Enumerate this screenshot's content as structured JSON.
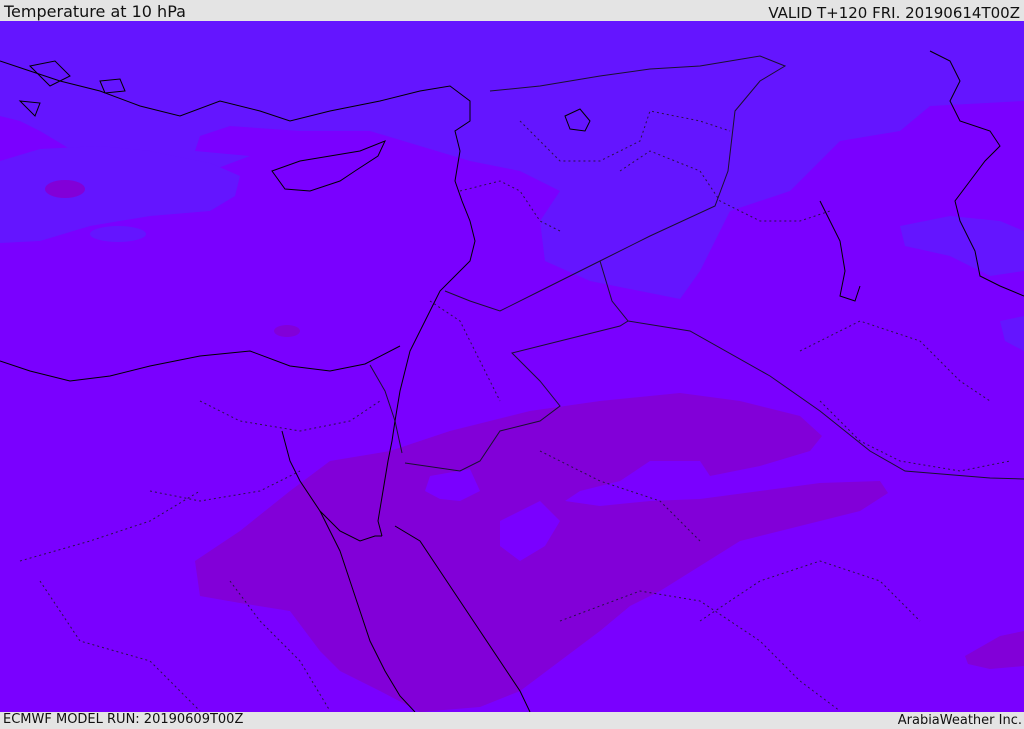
{
  "header": {
    "title": "Temperature at 10 hPa",
    "valid_time": "VALID T+120 FRI. 20190614T00Z"
  },
  "footer": {
    "model_run": "ECMWF MODEL RUN: 20190609T00Z",
    "credit": "ArabiaWeather Inc."
  },
  "map": {
    "base_fill": "#7a00ff",
    "cool_band_fill": "#6415ff",
    "warm_band_fill": "#8200d8",
    "border_color": "#1a1030",
    "coast_color": "#000000"
  }
}
